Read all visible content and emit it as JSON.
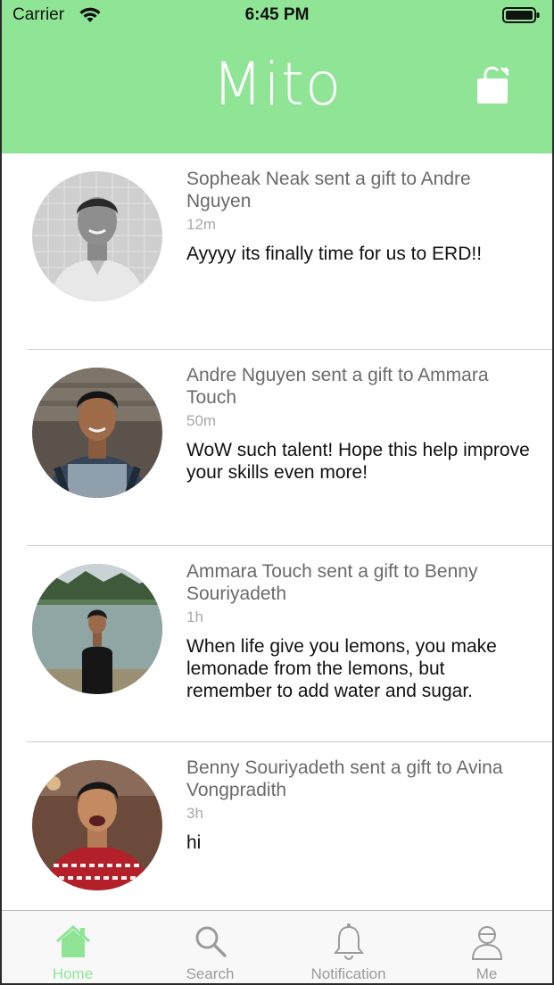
{
  "status_bar": {
    "carrier": "Carrier",
    "time": "6:45 PM"
  },
  "header": {
    "title": "Mito",
    "bag_icon": "shopping-bag-icon"
  },
  "feed": [
    {
      "headline": "Sopheak Neak sent a gift to Andre Nguyen",
      "ago": "12m",
      "message": "Ayyyy its finally time for us to ERD!!"
    },
    {
      "headline": "Andre Nguyen sent a gift to Ammara Touch",
      "ago": "50m",
      "message": "WoW such talent! Hope this help improve your skills even more!"
    },
    {
      "headline": "Ammara Touch sent a gift to Benny Souriyadeth",
      "ago": "1h",
      "message": "When life give you lemons, you make lemonade from the lemons, but remember to add water and sugar."
    },
    {
      "headline": "Benny Souriyadeth sent a gift to Avina Vongpradith",
      "ago": "3h",
      "message": "hi"
    }
  ],
  "tabbar": {
    "tabs": [
      {
        "label": "Home",
        "icon": "home-icon",
        "active": true
      },
      {
        "label": "Search",
        "icon": "search-icon",
        "active": false
      },
      {
        "label": "Notification",
        "icon": "bell-icon",
        "active": false
      },
      {
        "label": "Me",
        "icon": "user-icon",
        "active": false
      }
    ]
  },
  "colors": {
    "accent": "#8fe595",
    "inactive": "#9b9b9b",
    "divider": "#cfcfcf"
  }
}
